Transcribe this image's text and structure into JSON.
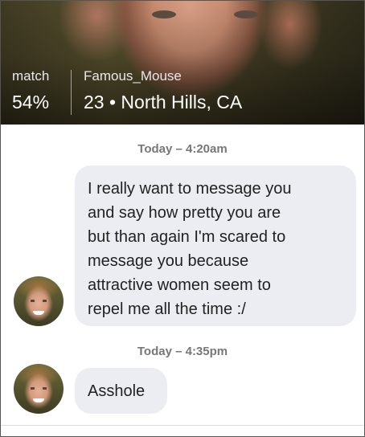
{
  "profile": {
    "match_label": "match",
    "match_value": "54%",
    "username": "Famous_Mouse",
    "info": "23 • North Hills, CA"
  },
  "conversation": {
    "messages": [
      {
        "timestamp": "Today – 4:20am",
        "lines": [
          "I really want to message you",
          "and say how pretty you are",
          "but than again I'm scared to",
          "message you because",
          "attractive women seem to",
          "repel me all the time :/"
        ]
      },
      {
        "timestamp": "Today – 4:35pm",
        "lines": [
          "Asshole"
        ]
      }
    ]
  },
  "colors": {
    "bubble_background": "#ececf3",
    "timestamp_text": "#777777"
  },
  "icons": {
    "avatar": "profile-photo-avatar"
  }
}
